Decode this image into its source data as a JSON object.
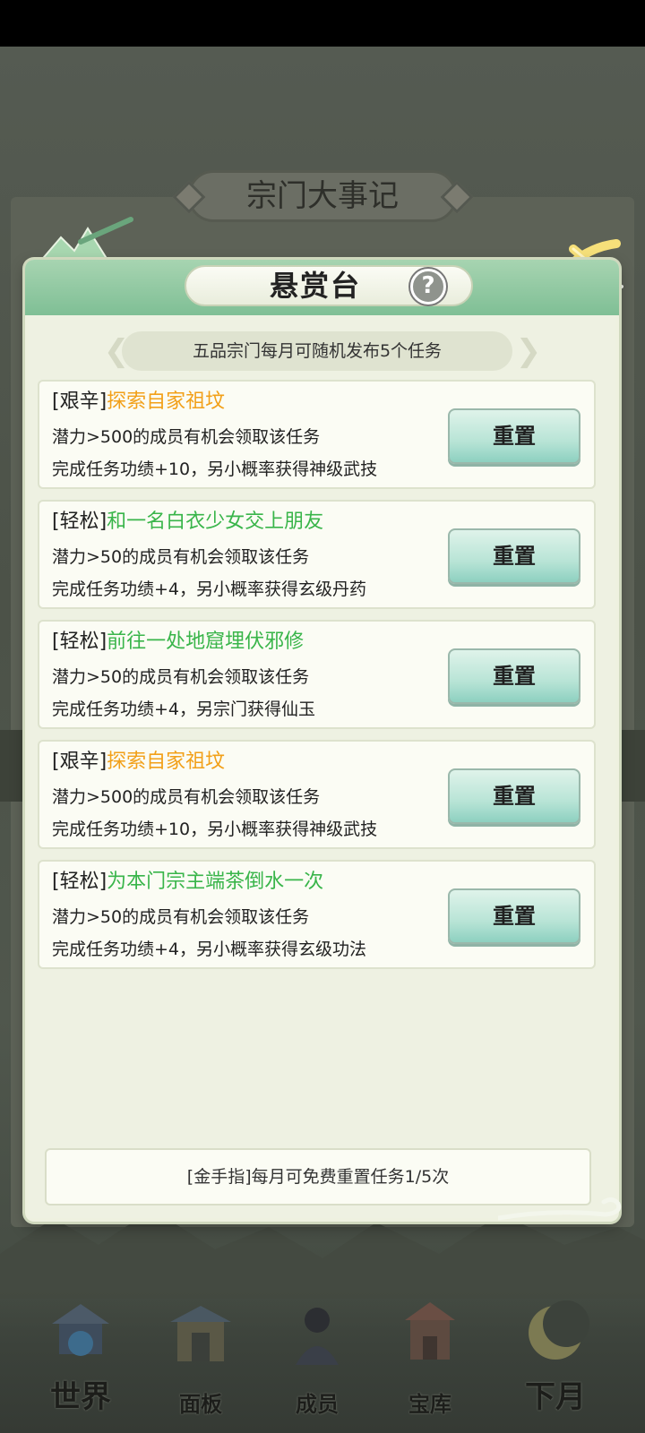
{
  "background": {
    "title": "宗门大事记"
  },
  "modal": {
    "title": "悬赏台",
    "help_symbol": "?",
    "subtitle": "五品宗门每月可随机发布5个任务",
    "tasks": [
      {
        "tag": "[艰辛]",
        "name": "探索自家祖坟",
        "difficulty": "hard",
        "requirement": "潜力>500的成员有机会领取该任务",
        "reward": "完成任务功绩+10，另小概率获得神级武技",
        "button": "重置"
      },
      {
        "tag": "[轻松]",
        "name": "和一名白衣少女交上朋友",
        "difficulty": "easy",
        "requirement": "潜力>50的成员有机会领取该任务",
        "reward": "完成任务功绩+4，另小概率获得玄级丹药",
        "button": "重置"
      },
      {
        "tag": "[轻松]",
        "name": "前往一处地窟埋伏邪修",
        "difficulty": "easy",
        "requirement": "潜力>50的成员有机会领取该任务",
        "reward": "完成任务功绩+4，另宗门获得仙玉",
        "button": "重置"
      },
      {
        "tag": "[艰辛]",
        "name": "探索自家祖坟",
        "difficulty": "hard",
        "requirement": "潜力>500的成员有机会领取该任务",
        "reward": "完成任务功绩+10，另小概率获得神级武技",
        "button": "重置"
      },
      {
        "tag": "[轻松]",
        "name": "为本门宗主端茶倒水一次",
        "difficulty": "easy",
        "requirement": "潜力>50的成员有机会领取该任务",
        "reward": "完成任务功绩+4，另小概率获得玄级功法",
        "button": "重置"
      }
    ],
    "footer_note": "[金手指]每月可免费重置任务1/5次"
  },
  "bottom_nav": {
    "items": [
      {
        "label": "世界",
        "icon": "world-palace-icon"
      },
      {
        "label": "面板",
        "icon": "panel-gate-icon"
      },
      {
        "label": "成员",
        "icon": "member-figure-icon"
      },
      {
        "label": "宝库",
        "icon": "treasury-tower-icon"
      },
      {
        "label": "下月",
        "icon": "crescent-moon-icon"
      }
    ]
  },
  "colors": {
    "hard_task": "#f2a019",
    "easy_task": "#39b54a",
    "header_green": "#8fc9a0",
    "button_mint": "#b8e4d6"
  }
}
